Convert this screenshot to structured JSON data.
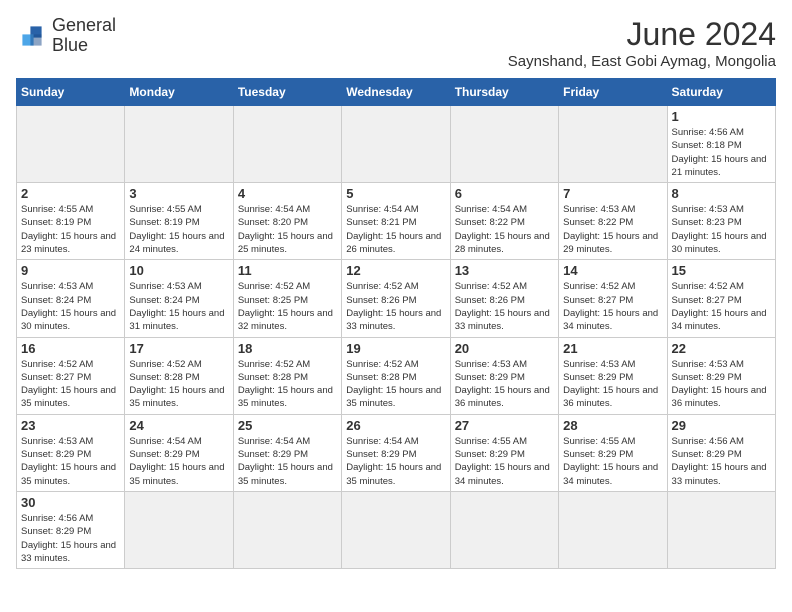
{
  "header": {
    "logo_line1": "General",
    "logo_line2": "Blue",
    "title": "June 2024",
    "subtitle": "Saynshand, East Gobi Aymag, Mongolia"
  },
  "days_of_week": [
    "Sunday",
    "Monday",
    "Tuesday",
    "Wednesday",
    "Thursday",
    "Friday",
    "Saturday"
  ],
  "weeks": [
    [
      {
        "day": "",
        "info": "",
        "empty": true
      },
      {
        "day": "",
        "info": "",
        "empty": true
      },
      {
        "day": "",
        "info": "",
        "empty": true
      },
      {
        "day": "",
        "info": "",
        "empty": true
      },
      {
        "day": "",
        "info": "",
        "empty": true
      },
      {
        "day": "",
        "info": "",
        "empty": true
      },
      {
        "day": "1",
        "info": "Sunrise: 4:56 AM\nSunset: 8:18 PM\nDaylight: 15 hours and 21 minutes."
      }
    ],
    [
      {
        "day": "2",
        "info": "Sunrise: 4:55 AM\nSunset: 8:19 PM\nDaylight: 15 hours and 23 minutes."
      },
      {
        "day": "3",
        "info": "Sunrise: 4:55 AM\nSunset: 8:19 PM\nDaylight: 15 hours and 24 minutes."
      },
      {
        "day": "4",
        "info": "Sunrise: 4:54 AM\nSunset: 8:20 PM\nDaylight: 15 hours and 25 minutes."
      },
      {
        "day": "5",
        "info": "Sunrise: 4:54 AM\nSunset: 8:21 PM\nDaylight: 15 hours and 26 minutes."
      },
      {
        "day": "6",
        "info": "Sunrise: 4:54 AM\nSunset: 8:22 PM\nDaylight: 15 hours and 28 minutes."
      },
      {
        "day": "7",
        "info": "Sunrise: 4:53 AM\nSunset: 8:22 PM\nDaylight: 15 hours and 29 minutes."
      },
      {
        "day": "8",
        "info": "Sunrise: 4:53 AM\nSunset: 8:23 PM\nDaylight: 15 hours and 30 minutes."
      }
    ],
    [
      {
        "day": "9",
        "info": "Sunrise: 4:53 AM\nSunset: 8:24 PM\nDaylight: 15 hours and 30 minutes."
      },
      {
        "day": "10",
        "info": "Sunrise: 4:53 AM\nSunset: 8:24 PM\nDaylight: 15 hours and 31 minutes."
      },
      {
        "day": "11",
        "info": "Sunrise: 4:52 AM\nSunset: 8:25 PM\nDaylight: 15 hours and 32 minutes."
      },
      {
        "day": "12",
        "info": "Sunrise: 4:52 AM\nSunset: 8:26 PM\nDaylight: 15 hours and 33 minutes."
      },
      {
        "day": "13",
        "info": "Sunrise: 4:52 AM\nSunset: 8:26 PM\nDaylight: 15 hours and 33 minutes."
      },
      {
        "day": "14",
        "info": "Sunrise: 4:52 AM\nSunset: 8:27 PM\nDaylight: 15 hours and 34 minutes."
      },
      {
        "day": "15",
        "info": "Sunrise: 4:52 AM\nSunset: 8:27 PM\nDaylight: 15 hours and 34 minutes."
      }
    ],
    [
      {
        "day": "16",
        "info": "Sunrise: 4:52 AM\nSunset: 8:27 PM\nDaylight: 15 hours and 35 minutes."
      },
      {
        "day": "17",
        "info": "Sunrise: 4:52 AM\nSunset: 8:28 PM\nDaylight: 15 hours and 35 minutes."
      },
      {
        "day": "18",
        "info": "Sunrise: 4:52 AM\nSunset: 8:28 PM\nDaylight: 15 hours and 35 minutes."
      },
      {
        "day": "19",
        "info": "Sunrise: 4:52 AM\nSunset: 8:28 PM\nDaylight: 15 hours and 35 minutes."
      },
      {
        "day": "20",
        "info": "Sunrise: 4:53 AM\nSunset: 8:29 PM\nDaylight: 15 hours and 36 minutes."
      },
      {
        "day": "21",
        "info": "Sunrise: 4:53 AM\nSunset: 8:29 PM\nDaylight: 15 hours and 36 minutes."
      },
      {
        "day": "22",
        "info": "Sunrise: 4:53 AM\nSunset: 8:29 PM\nDaylight: 15 hours and 36 minutes."
      }
    ],
    [
      {
        "day": "23",
        "info": "Sunrise: 4:53 AM\nSunset: 8:29 PM\nDaylight: 15 hours and 35 minutes."
      },
      {
        "day": "24",
        "info": "Sunrise: 4:54 AM\nSunset: 8:29 PM\nDaylight: 15 hours and 35 minutes."
      },
      {
        "day": "25",
        "info": "Sunrise: 4:54 AM\nSunset: 8:29 PM\nDaylight: 15 hours and 35 minutes."
      },
      {
        "day": "26",
        "info": "Sunrise: 4:54 AM\nSunset: 8:29 PM\nDaylight: 15 hours and 35 minutes."
      },
      {
        "day": "27",
        "info": "Sunrise: 4:55 AM\nSunset: 8:29 PM\nDaylight: 15 hours and 34 minutes."
      },
      {
        "day": "28",
        "info": "Sunrise: 4:55 AM\nSunset: 8:29 PM\nDaylight: 15 hours and 34 minutes."
      },
      {
        "day": "29",
        "info": "Sunrise: 4:56 AM\nSunset: 8:29 PM\nDaylight: 15 hours and 33 minutes."
      }
    ],
    [
      {
        "day": "30",
        "info": "Sunrise: 4:56 AM\nSunset: 8:29 PM\nDaylight: 15 hours and 33 minutes."
      },
      {
        "day": "",
        "info": "",
        "empty": true
      },
      {
        "day": "",
        "info": "",
        "empty": true
      },
      {
        "day": "",
        "info": "",
        "empty": true
      },
      {
        "day": "",
        "info": "",
        "empty": true
      },
      {
        "day": "",
        "info": "",
        "empty": true
      },
      {
        "day": "",
        "info": "",
        "empty": true
      }
    ]
  ]
}
